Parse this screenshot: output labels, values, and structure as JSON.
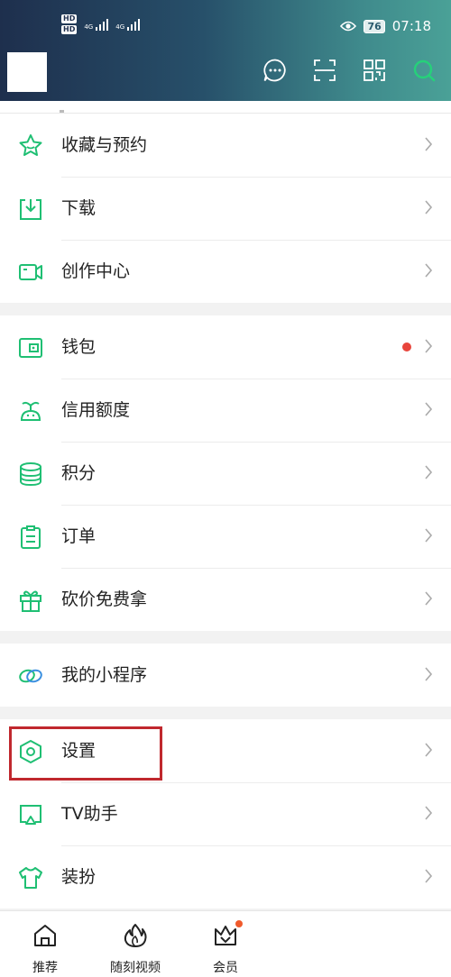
{
  "status_bar": {
    "hd1": "HD",
    "hd2": "HD",
    "net1": "4G",
    "net2": "4G",
    "battery": "76",
    "time": "07:18"
  },
  "header": {
    "icons": [
      "message-icon",
      "scan-icon",
      "qrcode-icon",
      "search-icon"
    ]
  },
  "menu": {
    "section1": [
      {
        "label": "收藏与预约",
        "icon": "star-icon"
      },
      {
        "label": "下载",
        "icon": "download-icon"
      },
      {
        "label": "创作中心",
        "icon": "video-camera-icon"
      }
    ],
    "section2": [
      {
        "label": "钱包",
        "icon": "wallet-icon",
        "badge": true
      },
      {
        "label": "信用额度",
        "icon": "credit-icon"
      },
      {
        "label": "积分",
        "icon": "coins-icon"
      },
      {
        "label": "订单",
        "icon": "clipboard-icon"
      },
      {
        "label": "砍价免费拿",
        "icon": "gift-icon"
      }
    ],
    "section3": [
      {
        "label": "我的小程序",
        "icon": "mini-program-icon"
      }
    ],
    "section4": [
      {
        "label": "设置",
        "icon": "settings-hexagon-icon",
        "highlighted": true
      },
      {
        "label": "TV助手",
        "icon": "tv-cast-icon"
      },
      {
        "label": "装扮",
        "icon": "tshirt-icon"
      }
    ]
  },
  "tabbar": {
    "tabs": [
      {
        "label": "推荐",
        "icon": "home-icon"
      },
      {
        "label": "随刻视频",
        "icon": "flame-icon"
      },
      {
        "label": "会员",
        "icon": "crown-icon",
        "badge": true
      }
    ]
  },
  "colors": {
    "accent": "#1fbf73",
    "badge_red": "#e8453c",
    "highlight_box": "#c0282e"
  }
}
